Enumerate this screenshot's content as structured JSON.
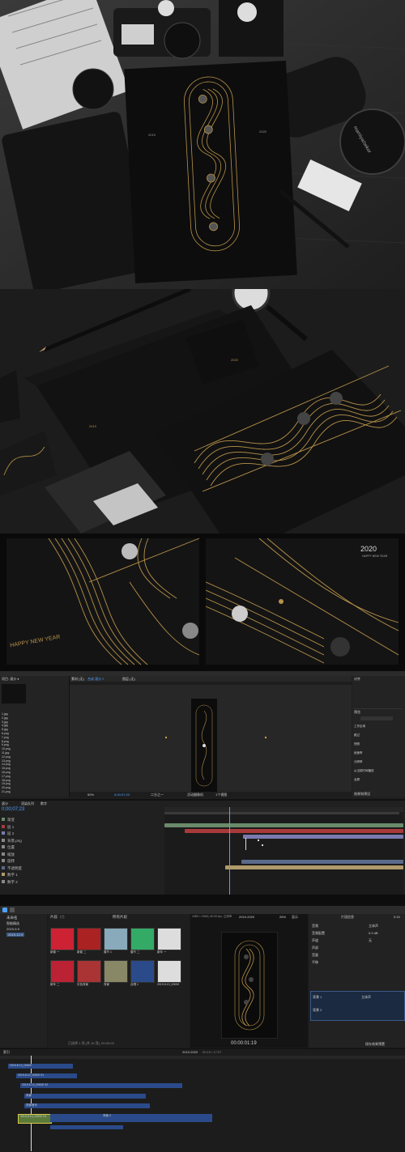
{
  "card": {
    "year": "2019",
    "year2": "2020",
    "greeting": "HAPPY NEW YEAR"
  },
  "detail": {
    "year": "2020",
    "greeting_top": "HAPPY NEW YEAR",
    "greeting_left": "HAPPY NEW YEAR"
  },
  "camera": {
    "brand": "mamiya/sekor"
  },
  "ae": {
    "project_label": "项目: 滚沙 ▾",
    "comp_tab": "合成 滚沙 ≡",
    "layer_tab": "图层 (无)",
    "footage_tab": "素材 (无)",
    "preview_tab": "预览",
    "effects_tab": "效果和预设",
    "align_tab": "对齐",
    "zoom": "50%",
    "resolution": "二分之一",
    "timecode": "0;00;07;23",
    "active_camera": "活动摄像机",
    "view_count": "1个视图",
    "timeline_tabs": [
      "滚沙",
      "渲染队列",
      "数字"
    ],
    "project_items": [
      "1.jpg",
      "2.jpg",
      "3.jpg",
      "4.jpg",
      "5.jpg",
      "6.png",
      "7.png",
      "8.png",
      "9.png",
      "10.png",
      "11.jpg",
      "12.png",
      "13.png",
      "14.png",
      "15.png",
      "16.png",
      "17.png",
      "18.png",
      "19.png",
      "20.png",
      "21.png"
    ],
    "layers": [
      "渐变",
      "层 1",
      "层 2",
      "背景.png",
      "位置",
      "缩放",
      "旋转",
      "不透明度",
      "数字 1",
      "数字 2"
    ],
    "shortcuts": [
      "Ctrl",
      "Alt",
      "Shift"
    ],
    "panel_labels": [
      "工作区域",
      "跳过",
      "快照",
      "帧速率",
      "分辨率",
      "从当前时间播放",
      "全屏"
    ]
  },
  "fcp": {
    "library": "未命名",
    "library_items": [
      "智能精选",
      "2019-9-9",
      "2019-12-9"
    ],
    "browser_title": "片段",
    "browser_count": "(7)",
    "filter": "所有片段",
    "format": "1080 × 2048 | 30.00 fps, 立体声",
    "project_name": "2019-2020",
    "zoom": "26%",
    "display": "显示",
    "timecode": "00:00:01:19",
    "selected_info": "已选择 1 项 (共 16 项), 00:00:03",
    "timeline_tab": "索引",
    "timeline_project": "2019-2020",
    "timeline_duration": "00:19 / 17:07",
    "inspector_title": "片段信息",
    "inspector_time": "0:15",
    "inspector_rows": [
      "音频",
      "音频配置",
      "声道",
      "声部",
      "音量",
      "平移"
    ],
    "inspector_values": [
      "立体声",
      "0.0 dB",
      "无"
    ],
    "inspector_footer": "保存效果预置",
    "audio_tracks": [
      "背景 1",
      "立体声",
      "背景 2"
    ],
    "clips": [
      "2019.8.13_00000",
      "2019.8.13_00000 01",
      "2019.8.13_00000 02",
      "背景",
      "背景音乐",
      "2019.8.13_00000 04",
      "背景 2"
    ],
    "thumb_labels": [
      "新春 一",
      "新春 二",
      "春节 1",
      "春节 二",
      "新年 一",
      "新年 二",
      "灰色背景",
      "背景",
      "合唱 1",
      "2019.8.13_00000"
    ]
  }
}
